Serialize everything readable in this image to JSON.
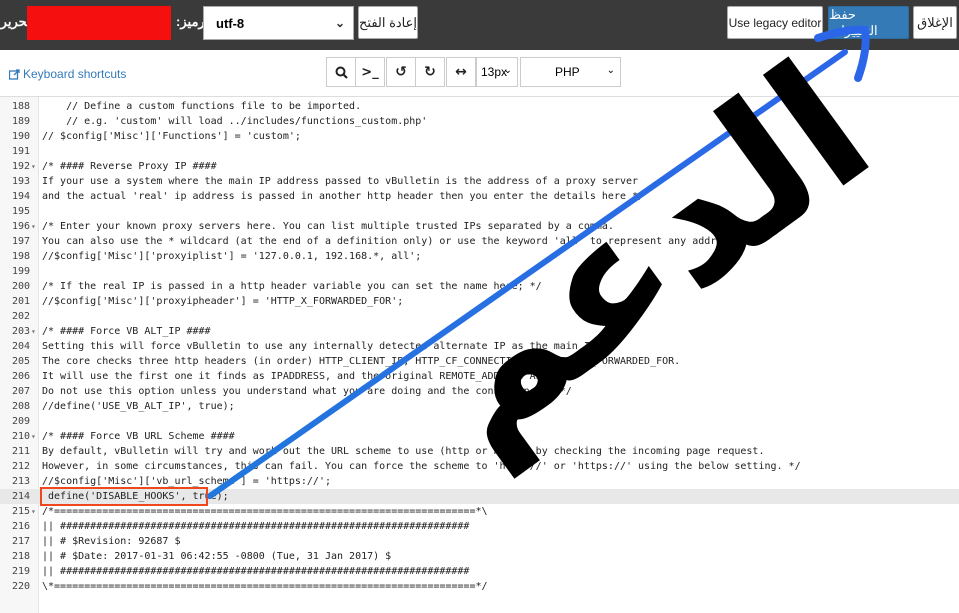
{
  "topbar": {
    "edit_label": "تحرير:",
    "encoding_label": ":الترميز",
    "encoding_value": "utf-8",
    "reopen_label": "إعادة الفتح",
    "legacy_label": "Use legacy editor",
    "save_label": "حفظ التغييرات",
    "close_label": "الإغلاق"
  },
  "toolbar": {
    "keyboard_shortcuts": "Keyboard shortcuts",
    "font_size": "13px",
    "mode": "PHP",
    "tools": [
      "search-icon",
      "terminal-icon",
      "undo-icon",
      "redo-icon",
      "wrap-icon"
    ]
  },
  "overlay": {
    "watermark": "الدعم"
  },
  "editor": {
    "active_line": 214,
    "lines": [
      {
        "n": "188",
        "fold": "",
        "code": "    // Define a custom functions file to be imported."
      },
      {
        "n": "189",
        "fold": "",
        "code": "    // e.g. 'custom' will load ../includes/functions_custom.php'"
      },
      {
        "n": "190",
        "fold": "",
        "code": "// $config['Misc']['Functions'] = 'custom';"
      },
      {
        "n": "191",
        "fold": "",
        "code": ""
      },
      {
        "n": "192",
        "fold": "▾",
        "code": "/* #### Reverse Proxy IP ####"
      },
      {
        "n": "193",
        "fold": "",
        "code": "If your use a system where the main IP address passed to vBulletin is the address of a proxy server"
      },
      {
        "n": "194",
        "fold": "",
        "code": "and the actual 'real' ip address is passed in another http header then you enter the details here */"
      },
      {
        "n": "195",
        "fold": "",
        "code": ""
      },
      {
        "n": "196",
        "fold": "▾",
        "code": "/* Enter your known proxy servers here. You can list multiple trusted IPs separated by a comma."
      },
      {
        "n": "197",
        "fold": "",
        "code": "You can also use the * wildcard (at the end of a definition only) or use the keyword 'all' to represent any address.*/"
      },
      {
        "n": "198",
        "fold": "",
        "code": "//$config['Misc']['proxyiplist'] = '127.0.0.1, 192.168.*, all';"
      },
      {
        "n": "199",
        "fold": "",
        "code": ""
      },
      {
        "n": "200",
        "fold": "",
        "code": "/* If the real IP is passed in a http header variable you can set the name here; */"
      },
      {
        "n": "201",
        "fold": "",
        "code": "//$config['Misc']['proxyipheader'] = 'HTTP_X_FORWARDED_FOR';"
      },
      {
        "n": "202",
        "fold": "",
        "code": ""
      },
      {
        "n": "203",
        "fold": "▾",
        "code": "/* #### Force VB ALT_IP ####"
      },
      {
        "n": "204",
        "fold": "",
        "code": "Setting this will force vBulletin to use any internally detected alternate IP as the main IP."
      },
      {
        "n": "205",
        "fold": "",
        "code": "The core checks three http headers (in order) HTTP_CLIENT_IP, HTTP_CF_CONNECTING_IP, HTTP_X_FORWARDED_FOR."
      },
      {
        "n": "206",
        "fold": "",
        "code": "It will use the first one it finds as IPADDRESS, and the original REMOTE_ADDR as ALT_IP."
      },
      {
        "n": "207",
        "fold": "",
        "code": "Do not use this option unless you understand what you are doing and the consequences. */"
      },
      {
        "n": "208",
        "fold": "",
        "code": "//define('USE_VB_ALT_IP', true);"
      },
      {
        "n": "209",
        "fold": "",
        "code": ""
      },
      {
        "n": "210",
        "fold": "▾",
        "code": "/* #### Force VB URL Scheme ####"
      },
      {
        "n": "211",
        "fold": "",
        "code": "By default, vBulletin will try and work out the URL scheme to use (http or https) by checking the incoming page request."
      },
      {
        "n": "212",
        "fold": "",
        "code": "However, in some circumstances, this can fail. You can force the scheme to 'http://' or 'https://' using the below setting. */"
      },
      {
        "n": "213",
        "fold": "",
        "code": "//$config['Misc']['vb_url_scheme'] = 'https://';"
      },
      {
        "n": "214",
        "fold": "",
        "code": " define('DISABLE_HOOKS', true);"
      },
      {
        "n": "215",
        "fold": "▾",
        "code": "/*======================================================================*\\"
      },
      {
        "n": "216",
        "fold": "",
        "code": "|| ####################################################################"
      },
      {
        "n": "217",
        "fold": "",
        "code": "|| # $Revision: 92687 $"
      },
      {
        "n": "218",
        "fold": "",
        "code": "|| # $Date: 2017-01-31 06:42:55 -0800 (Tue, 31 Jan 2017) $"
      },
      {
        "n": "219",
        "fold": "",
        "code": "|| ####################################################################"
      },
      {
        "n": "220",
        "fold": "",
        "code": "\\*======================================================================*/"
      }
    ]
  }
}
